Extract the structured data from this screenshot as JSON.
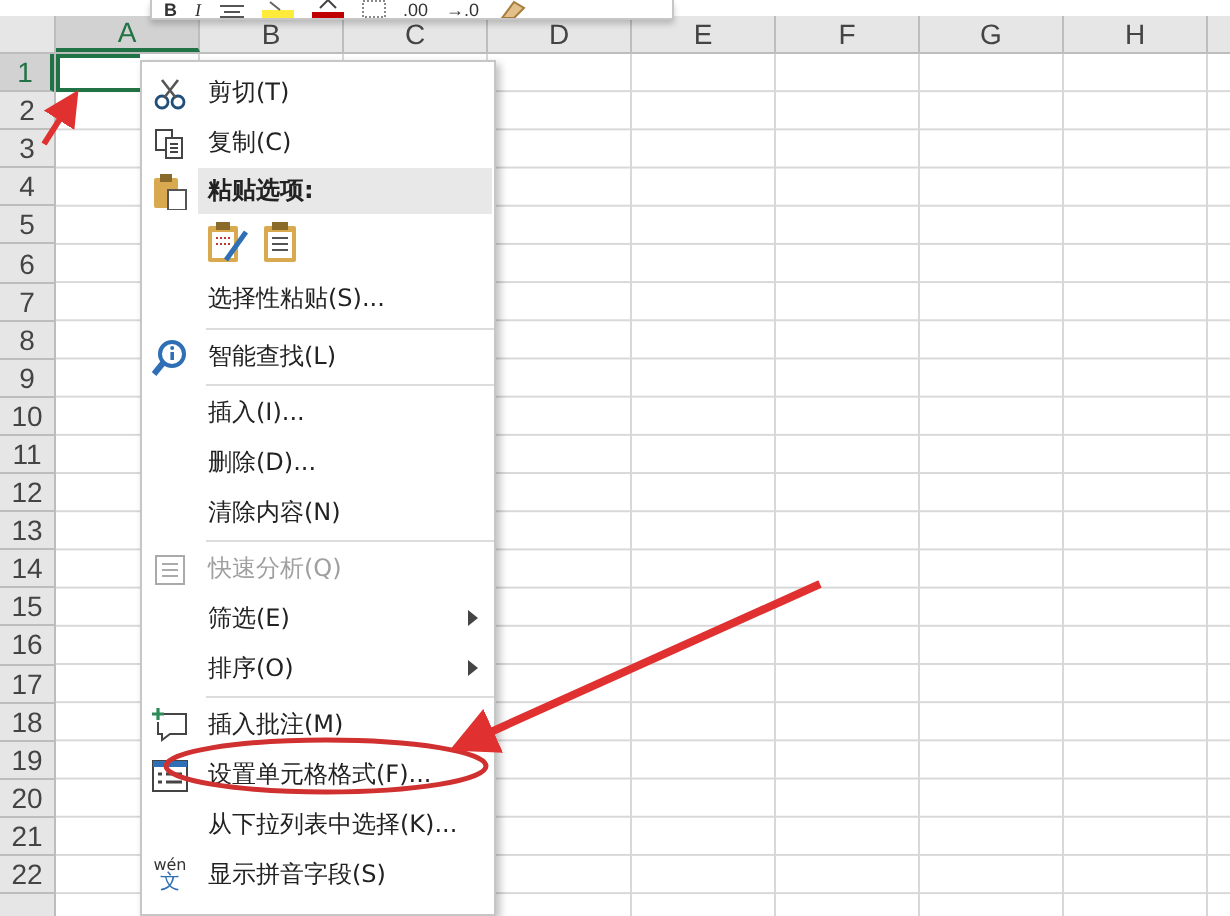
{
  "mini_toolbar": {
    "buttons": [
      "B",
      "I",
      ".00",
      "→.0"
    ]
  },
  "columns": [
    {
      "label": "A",
      "selected": true
    },
    {
      "label": "B",
      "selected": false
    },
    {
      "label": "C",
      "selected": false
    },
    {
      "label": "D",
      "selected": false
    },
    {
      "label": "E",
      "selected": false
    },
    {
      "label": "F",
      "selected": false
    },
    {
      "label": "G",
      "selected": false
    },
    {
      "label": "H",
      "selected": false
    }
  ],
  "rows": [
    {
      "label": "1",
      "selected": true
    },
    {
      "label": "2",
      "selected": false
    },
    {
      "label": "3",
      "selected": false
    },
    {
      "label": "4",
      "selected": false
    },
    {
      "label": "5",
      "selected": false
    },
    {
      "label": "6",
      "selected": false
    },
    {
      "label": "7",
      "selected": false
    },
    {
      "label": "8",
      "selected": false
    },
    {
      "label": "9",
      "selected": false
    },
    {
      "label": "10",
      "selected": false
    },
    {
      "label": "11",
      "selected": false
    },
    {
      "label": "12",
      "selected": false
    },
    {
      "label": "13",
      "selected": false
    },
    {
      "label": "14",
      "selected": false
    },
    {
      "label": "15",
      "selected": false
    },
    {
      "label": "16",
      "selected": false
    },
    {
      "label": "17",
      "selected": false
    },
    {
      "label": "18",
      "selected": false
    },
    {
      "label": "19",
      "selected": false
    },
    {
      "label": "20",
      "selected": false
    },
    {
      "label": "21",
      "selected": false
    },
    {
      "label": "22",
      "selected": false
    }
  ],
  "context_menu": [
    {
      "kind": "item",
      "label": "剪切(T)",
      "disabled": false,
      "submenu": false
    },
    {
      "kind": "item",
      "label": "复制(C)",
      "disabled": false,
      "submenu": false
    },
    {
      "kind": "header",
      "label": "粘贴选项:"
    },
    {
      "kind": "paste-icons"
    },
    {
      "kind": "item",
      "label": "选择性粘贴(S)...",
      "disabled": false,
      "submenu": false
    },
    {
      "kind": "separator"
    },
    {
      "kind": "item",
      "label": "智能查找(L)",
      "disabled": false,
      "submenu": false
    },
    {
      "kind": "separator"
    },
    {
      "kind": "item",
      "label": "插入(I)...",
      "disabled": false,
      "submenu": false
    },
    {
      "kind": "item",
      "label": "删除(D)...",
      "disabled": false,
      "submenu": false
    },
    {
      "kind": "item",
      "label": "清除内容(N)",
      "disabled": false,
      "submenu": false
    },
    {
      "kind": "separator"
    },
    {
      "kind": "item",
      "label": "快速分析(Q)",
      "disabled": true,
      "submenu": false
    },
    {
      "kind": "item",
      "label": "筛选(E)",
      "disabled": false,
      "submenu": true
    },
    {
      "kind": "item",
      "label": "排序(O)",
      "disabled": false,
      "submenu": true
    },
    {
      "kind": "separator"
    },
    {
      "kind": "item",
      "label": "插入批注(M)",
      "disabled": false,
      "submenu": false
    },
    {
      "kind": "item",
      "label": "设置单元格格式(F)...",
      "disabled": false,
      "submenu": false
    },
    {
      "kind": "item",
      "label": "从下拉列表中选择(K)...",
      "disabled": false,
      "submenu": false
    },
    {
      "kind": "item",
      "label": "显示拼音字段(S)",
      "disabled": false,
      "submenu": false,
      "icon_top": "wén",
      "icon_bottom": "文"
    }
  ]
}
